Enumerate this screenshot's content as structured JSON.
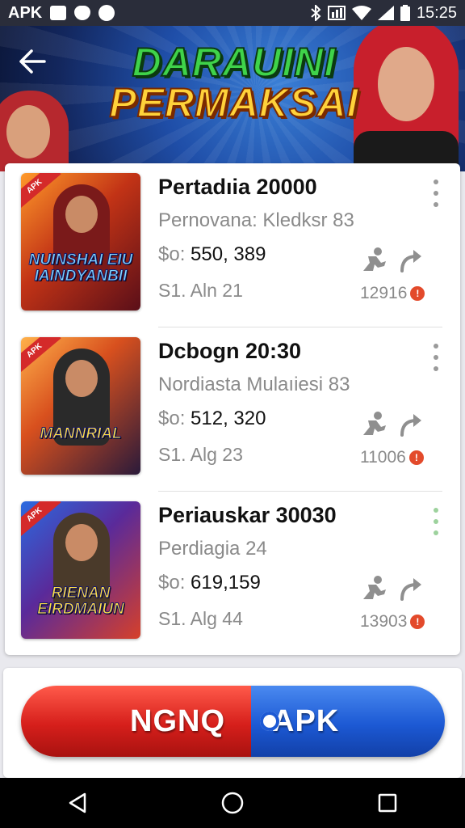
{
  "status_bar": {
    "carrier": "APK",
    "time": "15:25"
  },
  "banner": {
    "title_line1": "DARAUINI",
    "title_line2": "PERMAKSAI"
  },
  "items": [
    {
      "thumb_title": "NUINSHAI EIU IAINDYANBII",
      "thumb_ribbon": "APK",
      "name": "Pertadıia 20000",
      "subtitle": "Pernovana: Kledksr 83",
      "price_prefix": "$o:",
      "price": "550, 389",
      "date": "S1. Aln 21",
      "count": "12916"
    },
    {
      "thumb_title": "MANNRIAL",
      "thumb_ribbon": "APK",
      "name": "Dcbogn 20:30",
      "subtitle": "Nordiasta Mulaıiesi 83",
      "price_prefix": "$o:",
      "price": "512, 320",
      "date": "S1. Alg 23",
      "count": "11006"
    },
    {
      "thumb_title": "RIENAN EIRDMAIUN",
      "thumb_ribbon": "APK",
      "name": "Periauskar 30030",
      "subtitle": "Perdiagia 24",
      "price_prefix": "$o:",
      "price": "619,159",
      "date": "S1. Alg 44",
      "count": "13903"
    }
  ],
  "action_button": {
    "left_label": "NGNQ",
    "right_label": "APK"
  },
  "colors": {
    "red": "#d61f1b",
    "blue": "#1c59d4",
    "badge": "#e34a2b"
  }
}
